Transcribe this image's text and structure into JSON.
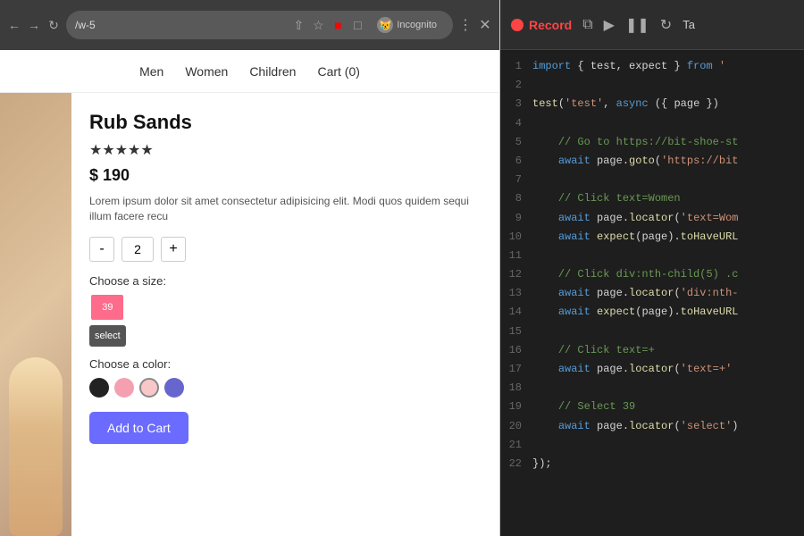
{
  "browser": {
    "url": "/w-5",
    "incognito_label": "Incognito"
  },
  "site": {
    "nav_items": [
      "Men",
      "Women",
      "Children",
      "Cart (0)"
    ]
  },
  "product": {
    "name": "Rub Sands",
    "stars": "★★★★★",
    "price": "$ 190",
    "description": "Lorem ipsum dolor sit amet consectetur adipisicing elit. Modi quos quidem sequi illum facere recu",
    "quantity": "2",
    "size_label": "Choose a size:",
    "selected_size": "39",
    "size_dropdown_label": "select",
    "color_label": "Choose a color:",
    "colors": [
      {
        "name": "black",
        "hex": "#222"
      },
      {
        "name": "pink",
        "hex": "#f4a0b0"
      },
      {
        "name": "light-pink",
        "hex": "#f8c8c8"
      },
      {
        "name": "blue",
        "hex": "#6666cc"
      }
    ],
    "add_to_cart_label": "Add to Cart"
  },
  "code_panel": {
    "record_label": "Record",
    "lines": [
      {
        "num": 1,
        "text": "import { test, expect } from '"
      },
      {
        "num": 2,
        "text": ""
      },
      {
        "num": 3,
        "text": "test('test', async ({ page })"
      },
      {
        "num": 4,
        "text": ""
      },
      {
        "num": 5,
        "text": "    // Go to https://bit-shoe-st"
      },
      {
        "num": 6,
        "text": "    await page.goto('https://bit"
      },
      {
        "num": 7,
        "text": ""
      },
      {
        "num": 8,
        "text": "    // Click text=Women"
      },
      {
        "num": 9,
        "text": "    await page.locator('text=Wom"
      },
      {
        "num": 10,
        "text": "    await expect(page).toHaveURL"
      },
      {
        "num": 11,
        "text": ""
      },
      {
        "num": 12,
        "text": "    // Click div:nth-child(5) .c"
      },
      {
        "num": 13,
        "text": "    await page.locator('div:nth-"
      },
      {
        "num": 14,
        "text": "    await expect(page).toHaveURL"
      },
      {
        "num": 15,
        "text": ""
      },
      {
        "num": 16,
        "text": "    // Click text=+"
      },
      {
        "num": 17,
        "text": "    await page.locator('text=+'"
      },
      {
        "num": 18,
        "text": ""
      },
      {
        "num": 19,
        "text": "    // Select 39"
      },
      {
        "num": 20,
        "text": "    await page.locator('select')"
      },
      {
        "num": 21,
        "text": ""
      },
      {
        "num": 22,
        "text": "});"
      }
    ]
  }
}
